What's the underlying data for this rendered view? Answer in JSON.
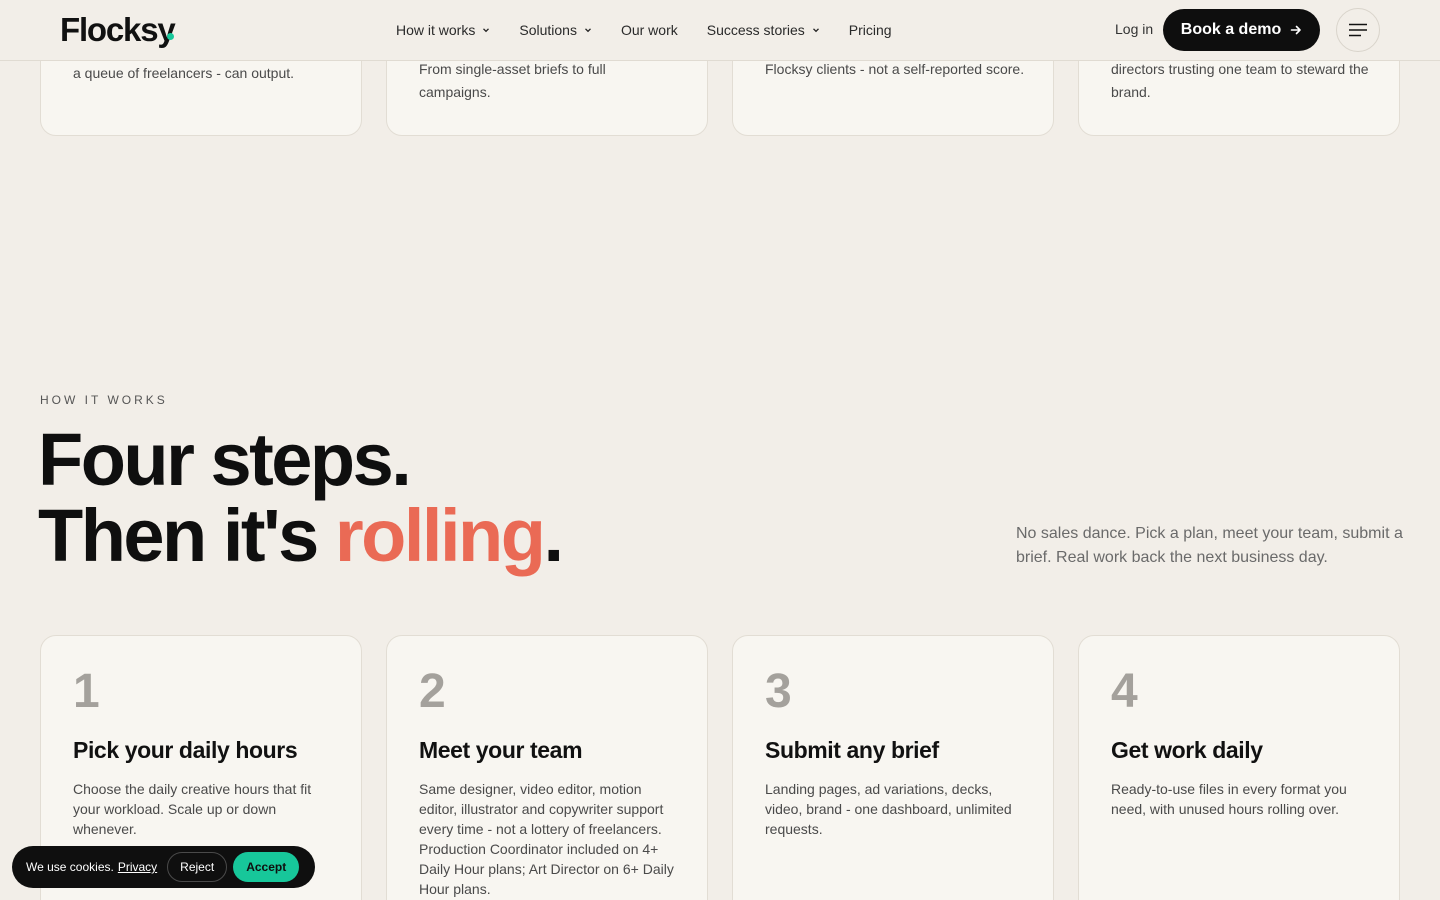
{
  "header": {
    "logo": "Flocksy",
    "nav": [
      {
        "label": "How it works",
        "has_dropdown": true
      },
      {
        "label": "Solutions",
        "has_dropdown": true
      },
      {
        "label": "Our work",
        "has_dropdown": false
      },
      {
        "label": "Success stories",
        "has_dropdown": true
      },
      {
        "label": "Pricing",
        "has_dropdown": false
      }
    ],
    "login_label": "Log in",
    "demo_label": "Book a demo",
    "menu_icon": "hamburger-icon",
    "accent_color": "#17c79a"
  },
  "top_cards": [
    {
      "text": "a queue of freelancers - can output."
    },
    {
      "text": "From single-asset briefs to full campaigns."
    },
    {
      "text": "Flocksy clients - not a self-reported score."
    },
    {
      "text": "directors trusting one team to steward the brand."
    }
  ],
  "how": {
    "eyebrow": "HOW IT WORKS",
    "headline_line1": "Four steps.",
    "headline_line2_prefix": "Then it's ",
    "headline_accent": "rolling",
    "headline_suffix": ".",
    "accent_color": "#ea6a55",
    "intro": "No sales dance. Pick a plan, meet your team, submit a brief. Real work back the next business day.",
    "steps": [
      {
        "num": "1",
        "title": "Pick your daily hours",
        "desc": "Choose the daily creative hours that fit your workload. Scale up or down whenever."
      },
      {
        "num": "2",
        "title": "Meet your team",
        "desc": "Same designer, video editor, motion editor, illustrator and copywriter support every time - not a lottery of freelancers. Production Coordinator included on 4+ Daily Hour plans; Art Director on 6+ Daily Hour plans."
      },
      {
        "num": "3",
        "title": "Submit any brief",
        "desc": "Landing pages, ad variations, decks, video, brand - one dashboard, unlimited requests."
      },
      {
        "num": "4",
        "title": "Get work daily",
        "desc": "Ready-to-use files in every format you need, with unused hours rolling over."
      }
    ]
  },
  "cookie": {
    "text": "We use cookies.",
    "link": "Privacy",
    "reject": "Reject",
    "accept": "Accept",
    "accept_color": "#17c79a"
  }
}
